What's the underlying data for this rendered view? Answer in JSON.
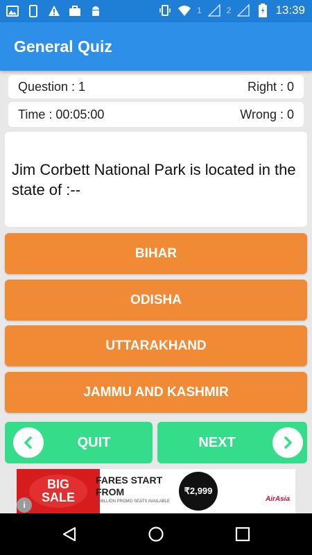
{
  "status_bar": {
    "time": "13:39",
    "sim1": "1",
    "sim2": "2",
    "left_icons": [
      "gallery-icon",
      "phone-icon",
      "warning-icon",
      "briefcase-icon",
      "android-icon"
    ],
    "right_icons": [
      "vibrate-icon",
      "wifi-icon",
      "signal-icon",
      "signal-icon",
      "battery-icon"
    ]
  },
  "app_bar": {
    "title": "General Quiz"
  },
  "info": {
    "question_label": "Question : 1",
    "right_label": "Right : 0",
    "time_label": "Time : 00:05:00",
    "wrong_label": "Wrong : 0"
  },
  "question": {
    "text": "Jim Corbett National Park  is located in the state of :--"
  },
  "options": [
    {
      "label": "BIHAR"
    },
    {
      "label": "ODISHA"
    },
    {
      "label": "UTTARAKHAND"
    },
    {
      "label": "JAMMU AND KASHMIR"
    }
  ],
  "buttons": {
    "quit_label": "QUIT",
    "next_label": "NEXT"
  },
  "ad": {
    "big_sale": "BIG SALE",
    "headline": "FARES START FROM",
    "fine_print": "2 MILLION PROMO SEATS AVAILABLE",
    "price": "₹2,999",
    "brand": "AirAsia",
    "info_icon": "i"
  },
  "colors": {
    "status_bar": "#1f7fd6",
    "app_bar": "#2e8fe8",
    "option": "#f08a35",
    "nav_button": "#35dd8a",
    "background": "#e8e8e8"
  }
}
